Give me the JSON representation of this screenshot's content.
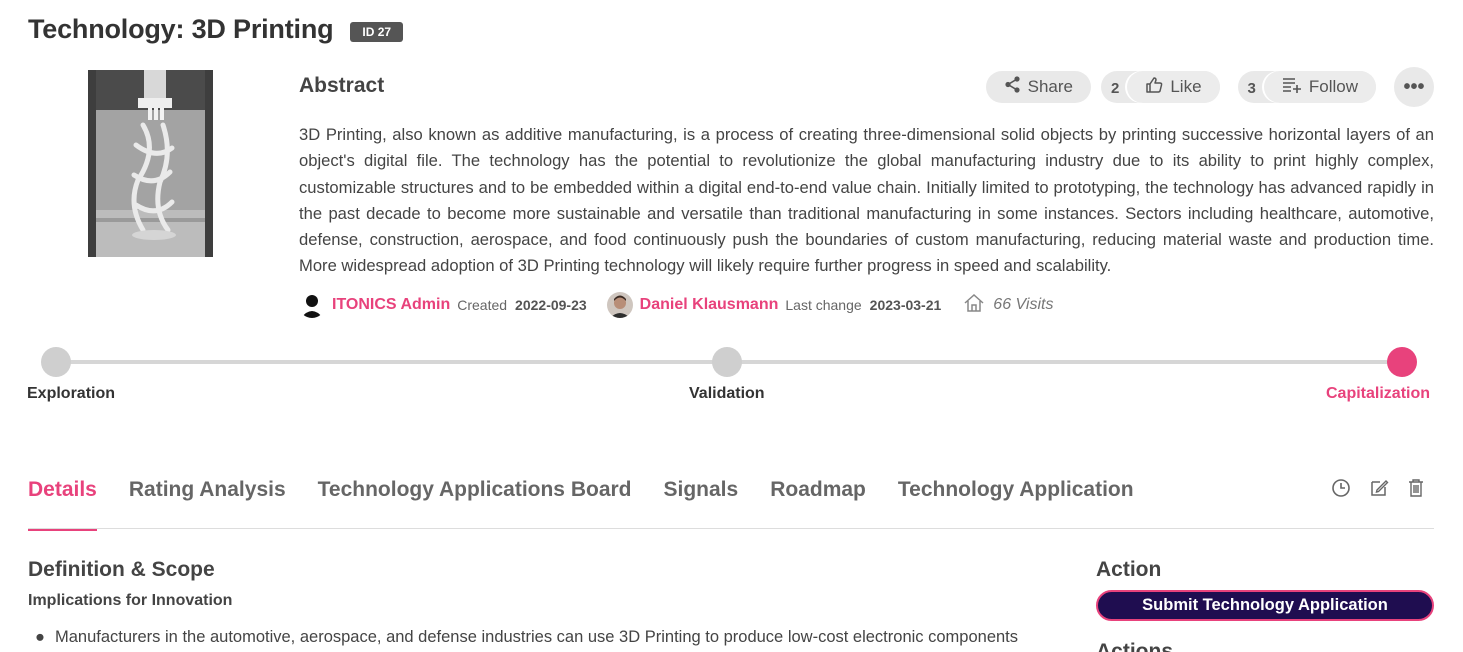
{
  "header": {
    "title": "Technology: 3D Printing",
    "id_badge": "ID 27"
  },
  "abstract": {
    "heading": "Abstract",
    "text": "3D Printing, also known as additive manufacturing, is a process of creating three-dimensional solid objects by printing successive horizontal layers of an object's digital file. The technology has the potential to revolutionize the global manufacturing industry due to its ability to print highly complex, customizable structures and to be embedded within a digital end-to-end value chain. Initially limited to prototyping, the technology has advanced rapidly in the past decade to become more sustainable and versatile than traditional manufacturing in some instances. Sectors including healthcare, automotive, defense, construction, aerospace, and food continuously push the boundaries of custom manufacturing, reducing material waste and production time. More widespread adoption of 3D Printing technology will likely require further progress in speed and scalability."
  },
  "actions": {
    "share_label": "Share",
    "like_count": "2",
    "like_label": "Like",
    "follow_count": "3",
    "follow_label": "Follow",
    "more_label": "•••"
  },
  "meta": {
    "creator_name": "ITONICS Admin",
    "created_label": "Created",
    "created_date": "2022-09-23",
    "modifier_name": "Daniel Klausmann",
    "changed_label": "Last change",
    "changed_date": "2023-03-21",
    "visits": "66 Visits"
  },
  "stages": [
    {
      "label": "Exploration",
      "active": false
    },
    {
      "label": "Validation",
      "active": false
    },
    {
      "label": "Capitalization",
      "active": true
    }
  ],
  "tabs": [
    {
      "label": "Details",
      "active": true
    },
    {
      "label": "Rating Analysis",
      "active": false
    },
    {
      "label": "Technology Applications Board",
      "active": false
    },
    {
      "label": "Signals",
      "active": false
    },
    {
      "label": "Roadmap",
      "active": false
    },
    {
      "label": "Technology Application",
      "active": false
    }
  ],
  "details": {
    "section_title": "Definition & Scope",
    "subsection_title": "Implications for Innovation",
    "bullets": [
      "Manufacturers in the automotive, aerospace, and defense industries can use 3D Printing to produce low-cost electronic components"
    ]
  },
  "sidebar": {
    "action_title": "Action",
    "submit_label": "Submit Technology Application",
    "second_title": "Actions"
  },
  "colors": {
    "accent": "#e8427c",
    "button_dark": "#1f0d50",
    "inactive_stage": "#cfcfcf"
  }
}
